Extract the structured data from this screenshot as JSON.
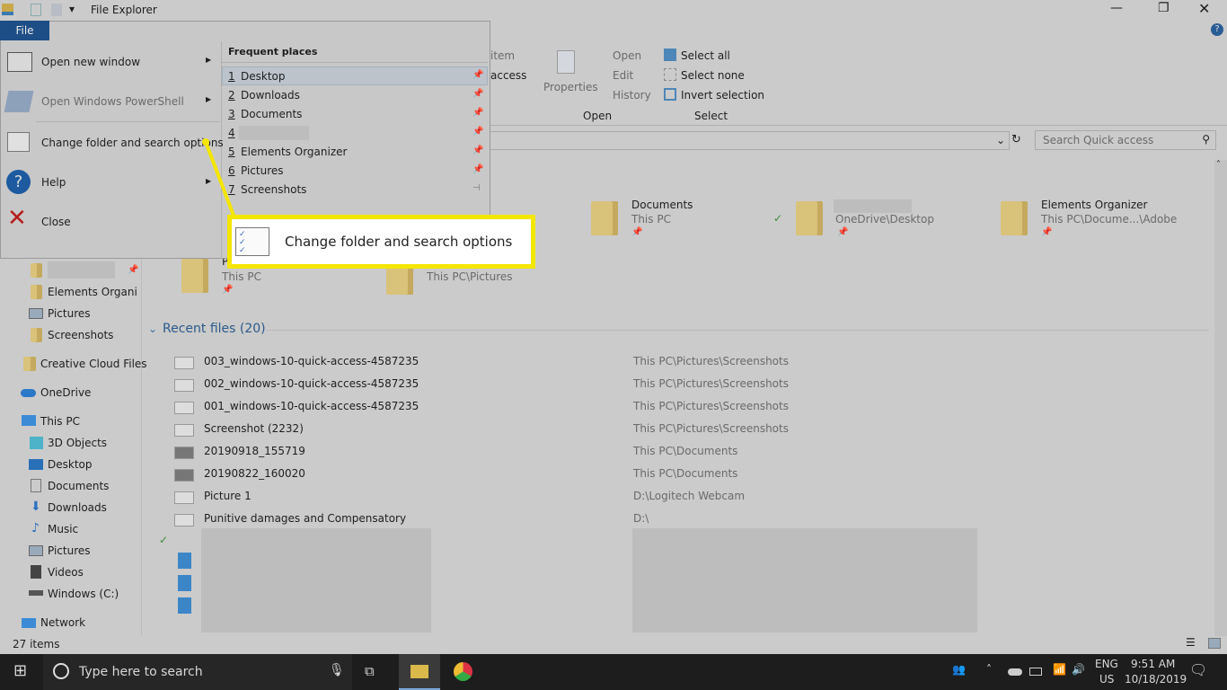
{
  "titlebar": {
    "title": "File Explorer"
  },
  "file_menu": {
    "tab": "File",
    "items": [
      {
        "label": "Open new window",
        "icon": "window-icon"
      },
      {
        "label": "Open Windows PowerShell",
        "icon": "powershell-icon"
      },
      {
        "label": "Change folder and search options",
        "icon": "options-icon"
      },
      {
        "label": "Help",
        "icon": "help-icon"
      },
      {
        "label": "Close",
        "icon": "close-x-icon"
      }
    ],
    "frequent_header": "Frequent places",
    "frequent": [
      {
        "num": "1",
        "label": "Desktop"
      },
      {
        "num": "2",
        "label": "Downloads"
      },
      {
        "num": "3",
        "label": "Documents"
      },
      {
        "num": "4",
        "label": ""
      },
      {
        "num": "5",
        "label": "Elements Organizer"
      },
      {
        "num": "6",
        "label": "Pictures"
      },
      {
        "num": "7",
        "label": "Screenshots"
      }
    ]
  },
  "callout": {
    "label": "Change folder and search options",
    "color": "#f4e600"
  },
  "ribbon": {
    "item": "item",
    "access": "access",
    "properties": "Properties",
    "open": "Open",
    "edit": "Edit",
    "history": "History",
    "select_all": "Select all",
    "select_none": "Select none",
    "invert": "Invert selection",
    "group_open": "Open",
    "group_select": "Select"
  },
  "search": {
    "placeholder": "Search Quick access"
  },
  "quick_access": [
    {
      "name": "Documents",
      "sub": "This PC"
    },
    {
      "name": "",
      "sub": "OneDrive\\Desktop"
    },
    {
      "name": "Elements Organizer",
      "sub": "This PC\\Docume...\\Adobe"
    },
    {
      "name": "P",
      "sub": "This PC"
    },
    {
      "name": "",
      "sub": "This PC\\Pictures"
    }
  ],
  "recent": {
    "header": "Recent files (20)",
    "files": [
      {
        "name": "003_windows-10-quick-access-4587235",
        "path": "This PC\\Pictures\\Screenshots"
      },
      {
        "name": "002_windows-10-quick-access-4587235",
        "path": "This PC\\Pictures\\Screenshots"
      },
      {
        "name": "001_windows-10-quick-access-4587235",
        "path": "This PC\\Pictures\\Screenshots"
      },
      {
        "name": "Screenshot (2232)",
        "path": "This PC\\Pictures\\Screenshots"
      },
      {
        "name": "20190918_155719",
        "path": "This PC\\Documents"
      },
      {
        "name": "20190822_160020",
        "path": "This PC\\Documents"
      },
      {
        "name": "Picture 1",
        "path": "D:\\Logitech Webcam"
      },
      {
        "name": "Punitive damages and Compensatory",
        "path": "D:\\"
      }
    ]
  },
  "nav": {
    "qa": [
      "",
      "Elements Organi",
      "Pictures",
      "Screenshots"
    ],
    "creative": "Creative Cloud Files",
    "onedrive": "OneDrive",
    "thispc": "This PC",
    "pc_items": [
      "3D Objects",
      "Desktop",
      "Documents",
      "Downloads",
      "Music",
      "Pictures",
      "Videos",
      "Windows (C:)"
    ],
    "network": "Network"
  },
  "status": {
    "count": "27 items"
  },
  "taskbar": {
    "search_placeholder": "Type here to search",
    "lang1": "ENG",
    "lang2": "US",
    "time": "9:51 AM",
    "date": "10/18/2019"
  }
}
